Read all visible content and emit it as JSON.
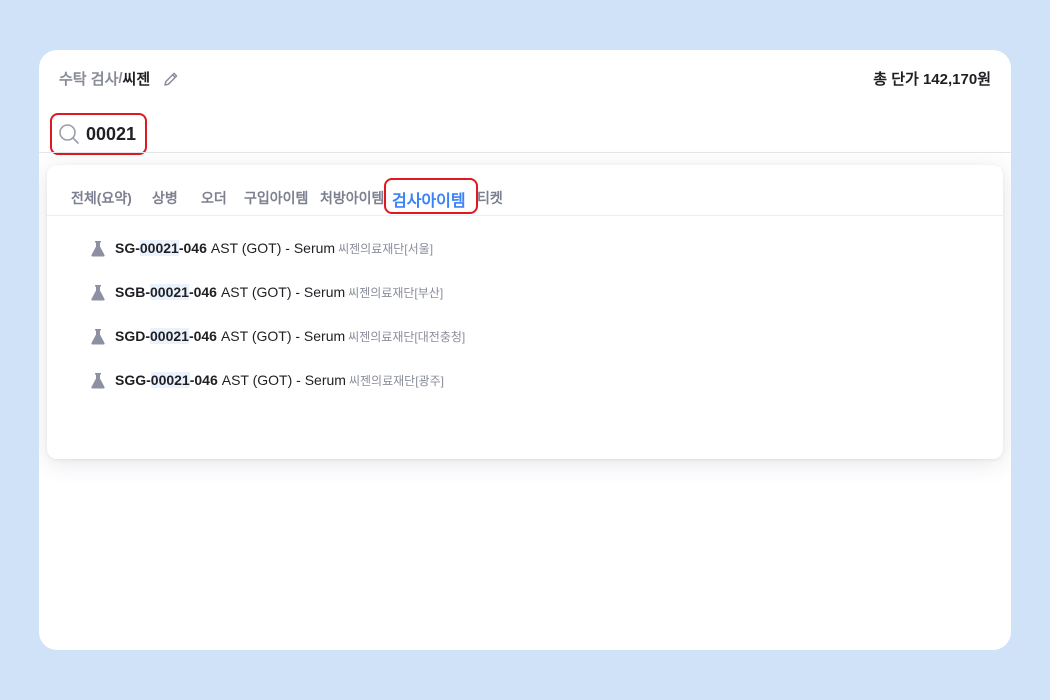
{
  "header": {
    "breadcrumb_parent": "수탁 검사",
    "breadcrumb_sep": "/",
    "breadcrumb_current": "씨젠",
    "total_price": "총 단가 142,170원"
  },
  "search": {
    "value": "00021"
  },
  "tabs": [
    {
      "label": "전체(요약)"
    },
    {
      "label": "상병"
    },
    {
      "label": "오더"
    },
    {
      "label": "구입아이템"
    },
    {
      "label": "처방아이템"
    },
    {
      "label": "검사아이템"
    },
    {
      "label": "티켓"
    }
  ],
  "active_tab": "검사아이템",
  "results": [
    {
      "prefix": "SG-",
      "match": "00021",
      "suffix": "-046",
      "name": "AST (GOT) - Serum",
      "lab": "씨젠의료재단[서울]"
    },
    {
      "prefix": "SGB-",
      "match": "00021",
      "suffix": "-046",
      "name": "AST (GOT) - Serum",
      "lab": "씨젠의료재단[부산]"
    },
    {
      "prefix": "SGD-",
      "match": "00021",
      "suffix": "-046",
      "name": "AST (GOT) - Serum",
      "lab": "씨젠의료재단[대전충청]"
    },
    {
      "prefix": "SGG-",
      "match": "00021",
      "suffix": "-046",
      "name": "AST (GOT) - Serum",
      "lab": "씨젠의료재단[광주]"
    }
  ],
  "icons": {
    "edit": "pencil-icon",
    "search": "search-icon",
    "result": "flask-icon"
  },
  "colors": {
    "background": "#cfe2f8",
    "active_tab": "#3b82f6",
    "highlight_box": "#e0181f",
    "match_bg": "#eaf2fd"
  }
}
